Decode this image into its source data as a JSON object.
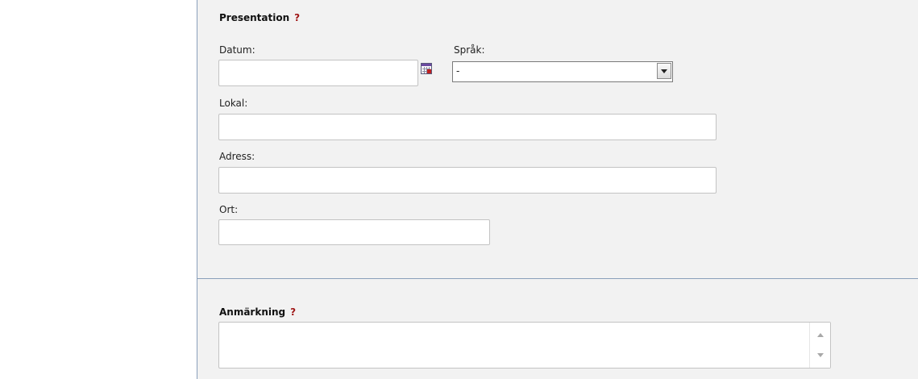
{
  "presentation": {
    "heading": "Presentation",
    "help": "?",
    "date_label": "Datum:",
    "date_value": "",
    "language_label": "Språk:",
    "language_selected": "-",
    "venue_label": "Lokal:",
    "venue_value": "",
    "address_label": "Adress:",
    "address_value": "",
    "city_label": "Ort:",
    "city_value": ""
  },
  "note": {
    "heading": "Anmärkning",
    "help": "?",
    "value": ""
  },
  "icons": {
    "calendar": "calendar-icon",
    "dropdown": "chevron-down-icon",
    "scroll_up": "arrow-up-icon",
    "scroll_down": "arrow-down-icon"
  }
}
